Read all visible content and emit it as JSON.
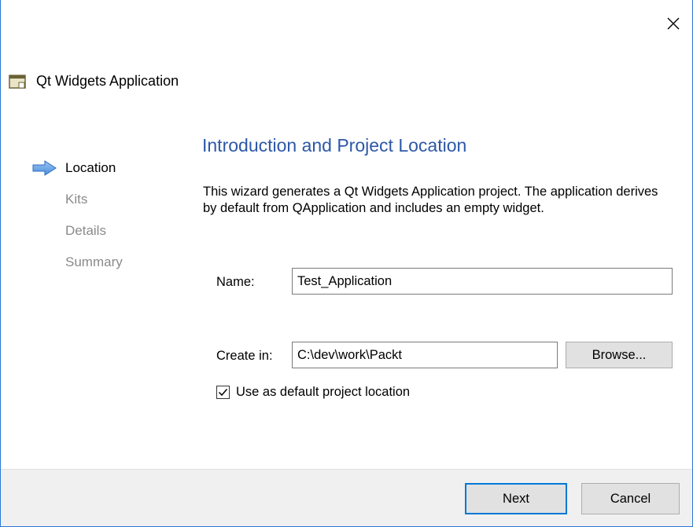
{
  "window": {
    "title": "Qt Widgets Application",
    "close_icon": "close-icon",
    "app_icon": "qt-app-window-icon"
  },
  "steps": [
    {
      "label": "Location",
      "active": true
    },
    {
      "label": "Kits",
      "active": false
    },
    {
      "label": "Details",
      "active": false
    },
    {
      "label": "Summary",
      "active": false
    }
  ],
  "page": {
    "title": "Introduction and Project Location",
    "description": "This wizard generates a Qt Widgets Application project. The application derives by default from QApplication and includes an empty widget."
  },
  "form": {
    "name_label": "Name:",
    "name_value": "Test_Application",
    "create_in_label": "Create in:",
    "create_in_value": "C:\\dev\\work\\Packt",
    "browse_label": "Browse...",
    "default_location_label": "Use as default project location",
    "default_location_checked": true
  },
  "footer": {
    "next_label": "Next",
    "cancel_label": "Cancel"
  },
  "colors": {
    "accent": "#2d58a8",
    "focus": "#0078d7",
    "inactive_step": "#8a8a8a"
  }
}
